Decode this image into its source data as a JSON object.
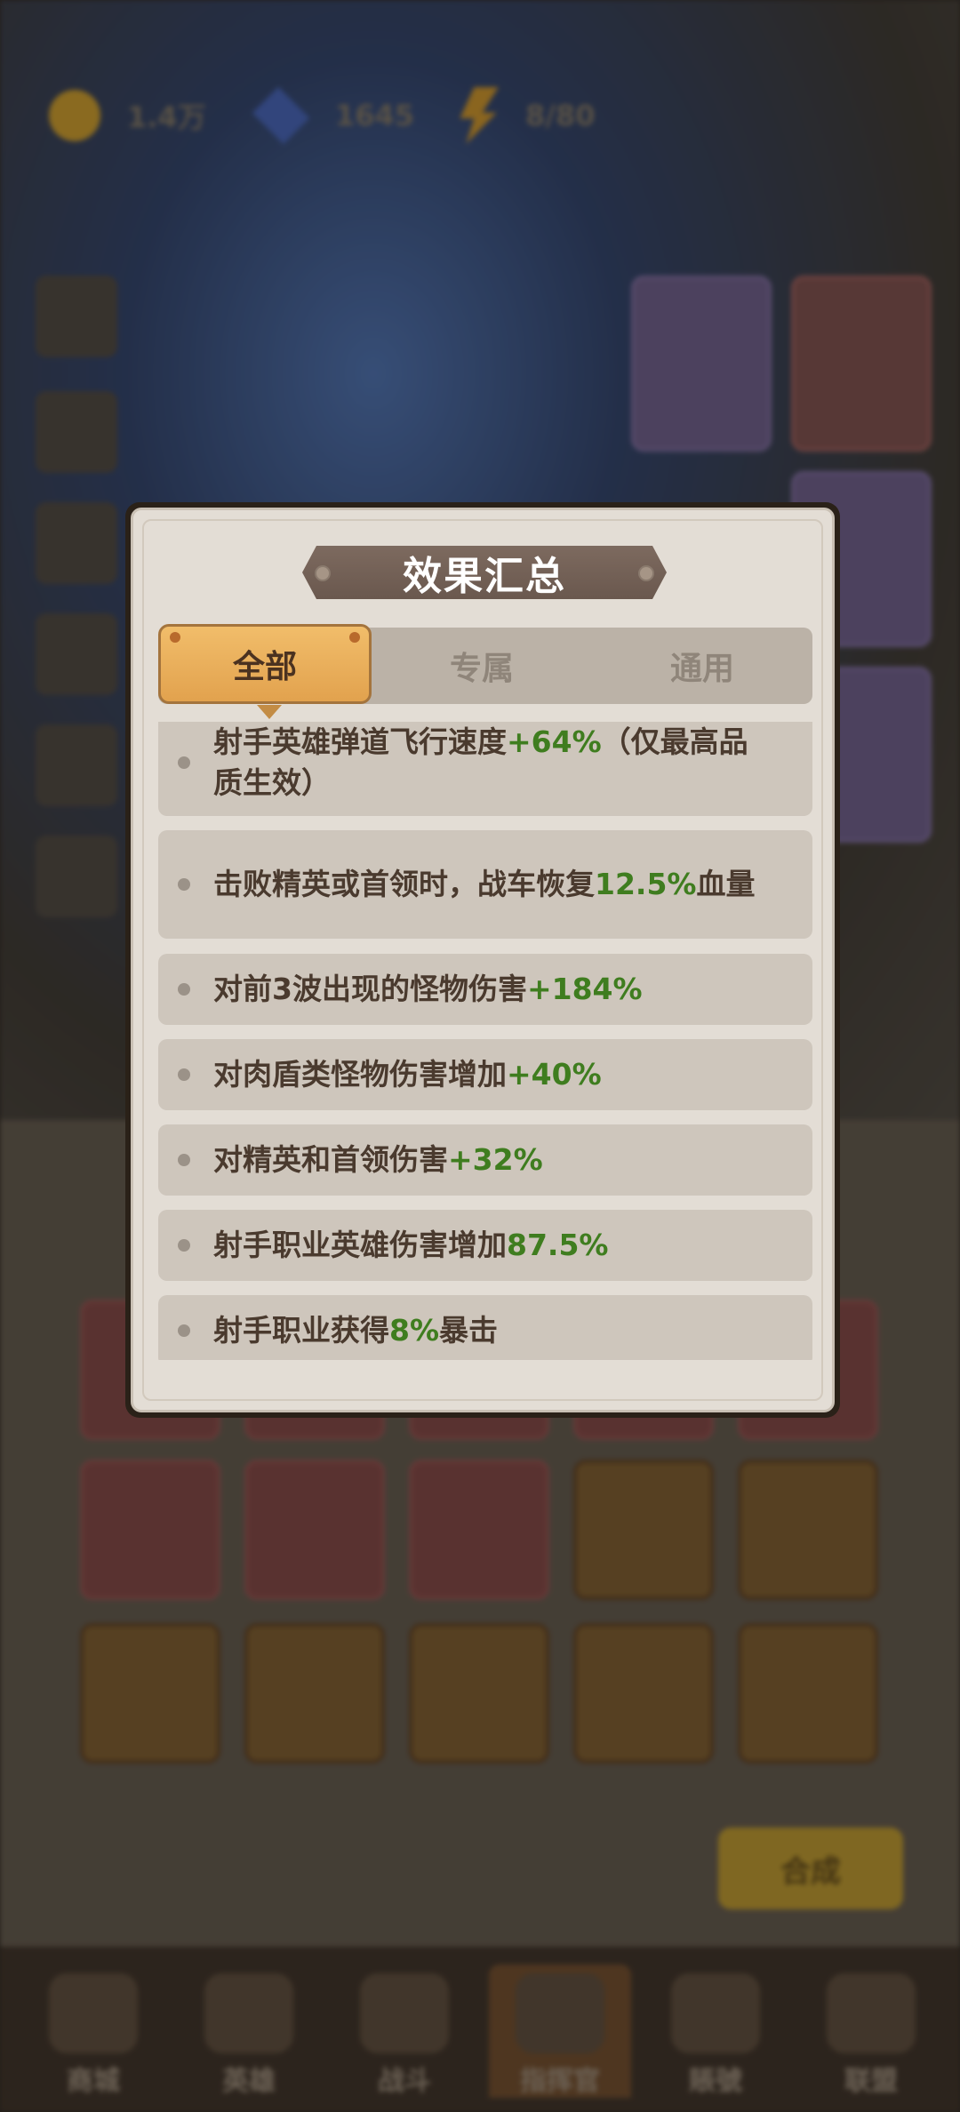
{
  "resources": {
    "gold": "1.4万",
    "gems": "1645",
    "energy": "8/80"
  },
  "modal": {
    "title": "效果汇总",
    "tabs": [
      {
        "label": "全部",
        "active": true
      },
      {
        "label": "专属",
        "active": false
      },
      {
        "label": "通用",
        "active": false
      }
    ],
    "effects": [
      {
        "prefix": "射手英雄弹道飞行速度",
        "value": "+64%",
        "suffix": "（仅最高品质生效）"
      },
      {
        "prefix": "击败精英或首领时，战车恢复",
        "value": "12.5%",
        "suffix": "血量"
      },
      {
        "prefix": "对前3波出现的怪物伤害",
        "value": "+184%",
        "suffix": ""
      },
      {
        "prefix": "对肉盾类怪物伤害增加",
        "value": "+40%",
        "suffix": ""
      },
      {
        "prefix": "对精英和首领伤害",
        "value": "+32%",
        "suffix": ""
      },
      {
        "prefix": "射手职业英雄伤害增加",
        "value": "87.5%",
        "suffix": ""
      },
      {
        "prefix": "射手职业获得",
        "value": "8%",
        "suffix": "暴击"
      }
    ]
  },
  "bottom": {
    "merge_label": "合成"
  },
  "nav": [
    {
      "label": "商城"
    },
    {
      "label": "英雄"
    },
    {
      "label": "战斗"
    },
    {
      "label": "指挥官"
    },
    {
      "label": "賬號"
    },
    {
      "label": "联盟"
    }
  ]
}
